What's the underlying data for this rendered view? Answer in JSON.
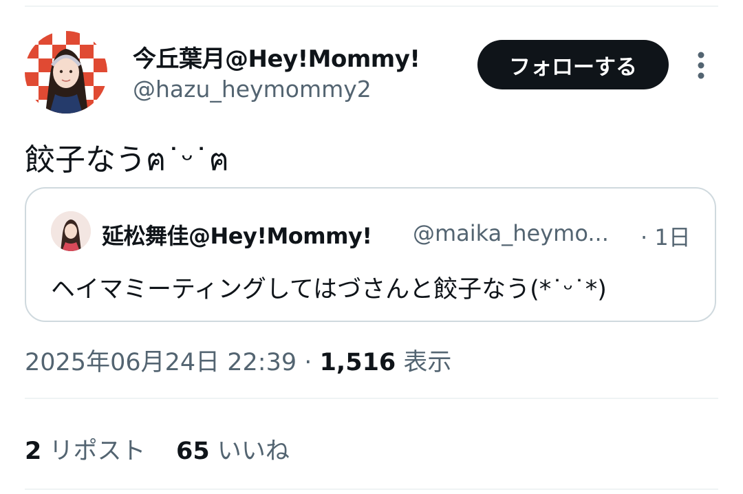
{
  "tweet": {
    "author_name": "今丘葉月@Hey!Mommy!",
    "author_handle": "@hazu_heymommy2",
    "follow_label": "フォローする",
    "text": "餃子なうฅ˙ᵕ˙ฅ",
    "timestamp": "2025年06月24日 22:39",
    "separator": "·",
    "views_count": "1,516",
    "views_label": "表示"
  },
  "quote": {
    "author_name": "延松舞佳@Hey!Mommy!",
    "author_handle": "@maika_heymo...",
    "time": "· 1日",
    "text": "ヘイマミーティングしてはづさんと餃子なう(*˙ᵕ˙*)"
  },
  "stats": {
    "reposts_count": "2",
    "reposts_label": "リポスト",
    "likes_count": "65",
    "likes_label": "いいね"
  },
  "colors": {
    "text_primary": "#0f1419",
    "text_secondary": "#536471",
    "button_bg": "#0f1419",
    "border": "#cfd9de",
    "divider": "#eff3f4",
    "avatar_accent": "#e04a33"
  },
  "icons": [
    "more-vertical-icon"
  ]
}
